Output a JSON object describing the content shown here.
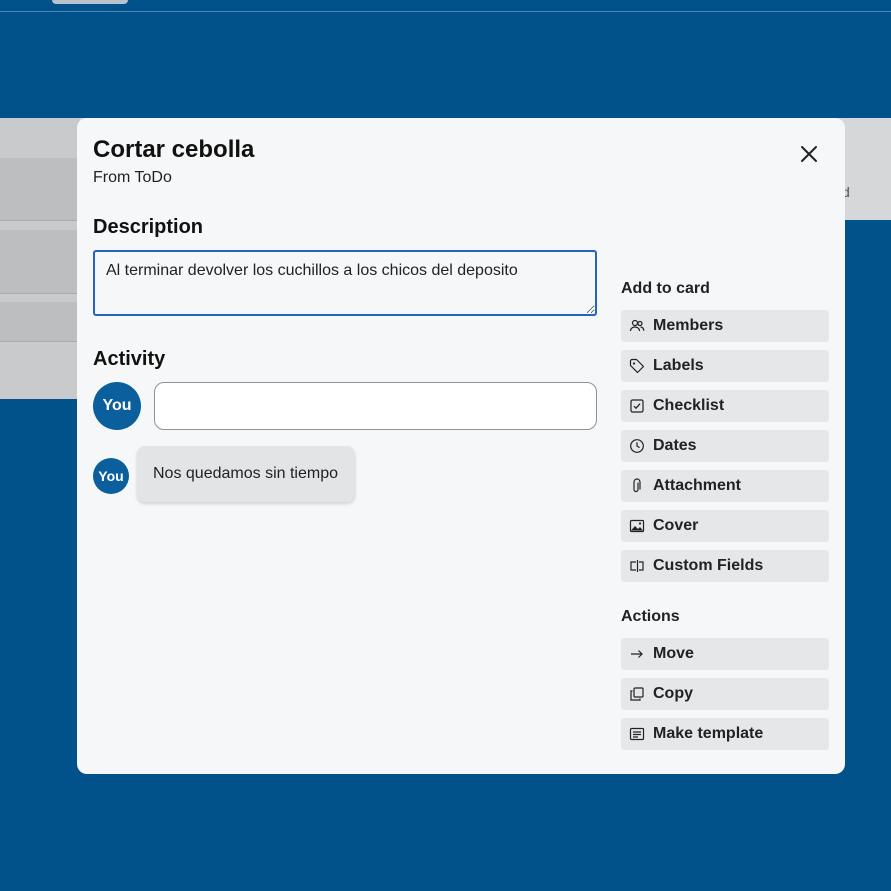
{
  "card": {
    "title": "Cortar cebolla",
    "from": "From ToDo",
    "description_heading": "Description",
    "description": "Al terminar devolver los cuchillos a los chicos del deposito",
    "activity_heading": "Activity",
    "comment_input_value": "",
    "avatar_label": "You",
    "comments": [
      {
        "author": "You",
        "text": "Nos quedamos sin tiempo"
      }
    ]
  },
  "sidebar": {
    "add_heading": "Add to card",
    "add_items": [
      {
        "label": "Members",
        "icon": "members-icon"
      },
      {
        "label": "Labels",
        "icon": "tag-icon"
      },
      {
        "label": "Checklist",
        "icon": "checklist-icon"
      },
      {
        "label": "Dates",
        "icon": "clock-icon"
      },
      {
        "label": "Attachment",
        "icon": "paperclip-icon"
      },
      {
        "label": "Cover",
        "icon": "image-icon"
      },
      {
        "label": "Custom Fields",
        "icon": "custom-fields-icon"
      }
    ],
    "actions_heading": "Actions",
    "action_items": [
      {
        "label": "Move",
        "icon": "arrow-right-icon"
      },
      {
        "label": "Copy",
        "icon": "copy-icon"
      },
      {
        "label": "Make template",
        "icon": "template-icon"
      }
    ]
  },
  "background": {
    "partial_text": "d"
  },
  "colors": {
    "page_bg": "#01528a",
    "modal_bg": "#f6f7f8",
    "accent": "#0a5f9c",
    "focus_border": "#2563c0",
    "button_bg": "#e6e7e9"
  }
}
